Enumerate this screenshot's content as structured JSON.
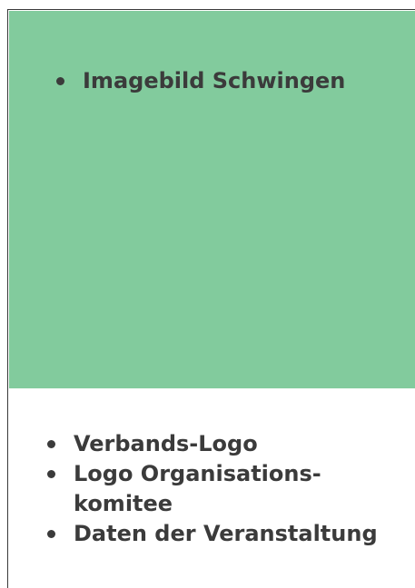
{
  "image_area": {
    "color": "#82cb9d",
    "items": [
      "Imagebild Schwingen"
    ]
  },
  "content": {
    "items": [
      [
        "Verbands-Logo"
      ],
      [
        "Logo Organisations-",
        "komitee"
      ],
      [
        "Daten der Veranstaltung"
      ]
    ]
  }
}
